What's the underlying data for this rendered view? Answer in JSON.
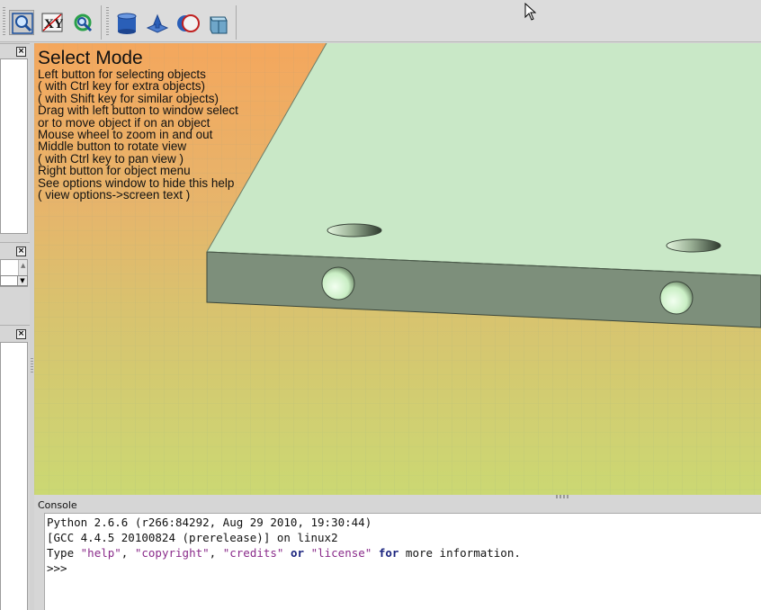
{
  "toolbar": {
    "left_group": [
      {
        "name": "fit-all-icon",
        "pressed": true
      },
      {
        "name": "view-xy-icon",
        "label": "XY",
        "pressed": false
      },
      {
        "name": "rotate-view-icon",
        "pressed": false
      }
    ],
    "right_group": [
      {
        "name": "cylinder-icon"
      },
      {
        "name": "extrude-icon"
      },
      {
        "name": "boolean-icon"
      },
      {
        "name": "prism-icon"
      }
    ]
  },
  "left_dock": {
    "close_glyph": "×"
  },
  "viewport": {
    "help_title": "Select Mode",
    "help_lines": [
      "Left button for selecting objects",
      "( with Ctrl key for extra objects)",
      "( with Shift key for similar objects)",
      "Drag with left button to window select",
      "or to move object if on an object",
      "Mouse wheel to zoom in and out",
      "Middle button to rotate view",
      "( with Ctrl key to pan view )",
      "Right button for object menu",
      "See options window to hide this help",
      "( view options->screen text )"
    ]
  },
  "console": {
    "title": "Console",
    "line1": "Python 2.6.6 (r266:84292, Aug 29 2010, 19:30:44)",
    "line2": "[GCC 4.4.5 20100824 (prerelease)] on linux2",
    "line3": {
      "t1": "Type ",
      "s1": "\"help\"",
      "c1": ", ",
      "s2": "\"copyright\"",
      "c2": ", ",
      "s3": "\"credits\"",
      "k1": " or ",
      "s4": "\"license\"",
      "k2": " for",
      "t2": " more information."
    },
    "prompt": ">>>"
  },
  "colors": {
    "plate_top": "#c9e8c7",
    "plate_side": "#7d8f7b",
    "hole": "#dff5da"
  }
}
